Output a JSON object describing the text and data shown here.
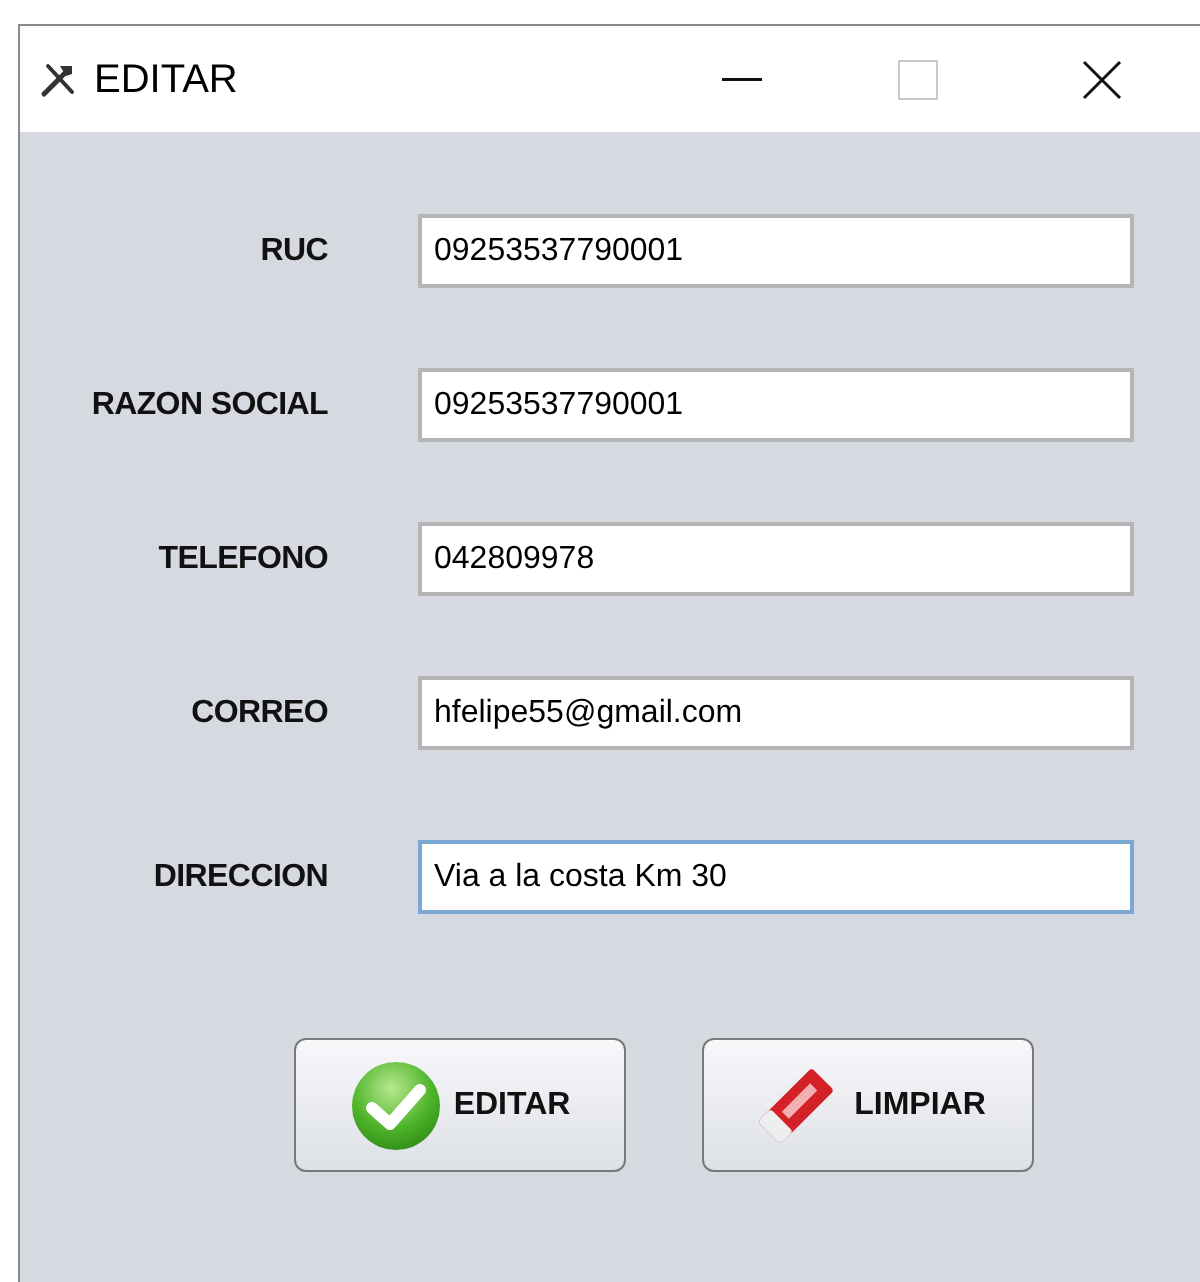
{
  "window": {
    "title": "EDITAR"
  },
  "fields": [
    {
      "label": "RUC",
      "value": "09253537790001",
      "focused": false
    },
    {
      "label": "RAZON SOCIAL",
      "value": "09253537790001",
      "focused": false
    },
    {
      "label": "TELEFONO",
      "value": "042809978",
      "focused": false
    },
    {
      "label": "CORREO",
      "value": "hfelipe55@gmail.com",
      "focused": false
    },
    {
      "label": "DIRECCION",
      "value": "Via a la costa Km 30",
      "focused": true
    }
  ],
  "buttons": [
    {
      "label": "EDITAR",
      "kind": "check"
    },
    {
      "label": "LIMPIAR",
      "kind": "eraser"
    }
  ]
}
